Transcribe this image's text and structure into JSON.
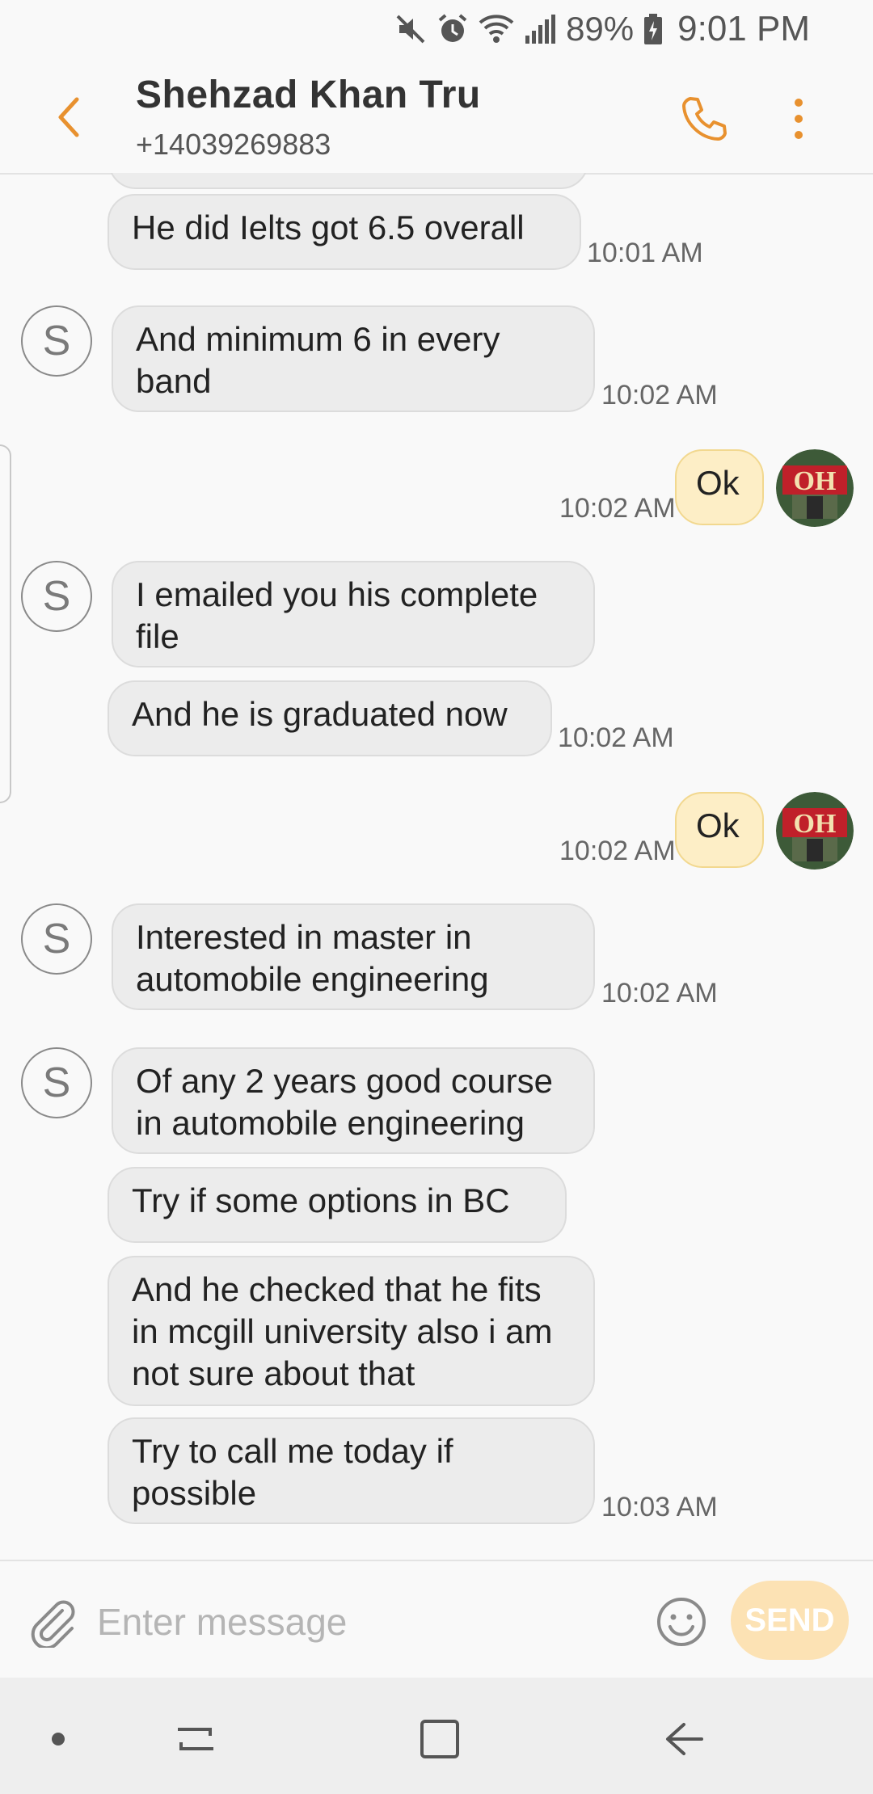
{
  "status_bar": {
    "battery": "89%",
    "time": "9:01 PM",
    "icons": [
      "mute-icon",
      "alarm-icon",
      "wifi-icon",
      "signal-icon",
      "battery-charging-icon"
    ]
  },
  "header": {
    "contact_name": "Shehzad Khan Tru",
    "phone": "+14039269883",
    "back_icon": "chevron-left-icon",
    "call_icon": "phone-icon",
    "more_icon": "more-vertical-icon"
  },
  "messages": [
    {
      "dir": "in",
      "text": "He did Ielts got 6.5 overall",
      "time": "10:01 AM"
    },
    {
      "dir": "in",
      "text": "And minimum 6 in every band",
      "time": "10:02 AM"
    },
    {
      "dir": "out",
      "text": "Ok",
      "time": "10:02 AM"
    },
    {
      "dir": "in",
      "text": "I emailed you his complete file",
      "time": ""
    },
    {
      "dir": "in",
      "text": "And he is graduated now",
      "time": "10:02 AM"
    },
    {
      "dir": "out",
      "text": "Ok",
      "time": "10:02 AM"
    },
    {
      "dir": "in",
      "text": "Interested in master in automobile engineering",
      "time": "10:02 AM"
    },
    {
      "dir": "in",
      "text": "Of any 2 years good course in automobile engineering",
      "time": ""
    },
    {
      "dir": "in",
      "text": "Try if some options in BC",
      "time": ""
    },
    {
      "dir": "in",
      "text": "And he checked that he fits in mcgill university also i am not sure about that",
      "time": ""
    },
    {
      "dir": "in",
      "text": "Try to call me today if possible",
      "time": "10:03 AM"
    }
  ],
  "sender_avatar_letter": "S",
  "input": {
    "placeholder": "Enter message",
    "value": "",
    "send_label": "SEND"
  },
  "colors": {
    "accent": "#e8912f",
    "incoming_bubble": "#ececec",
    "outgoing_bubble": "#fdeec6",
    "send_button": "#fce2b4"
  }
}
